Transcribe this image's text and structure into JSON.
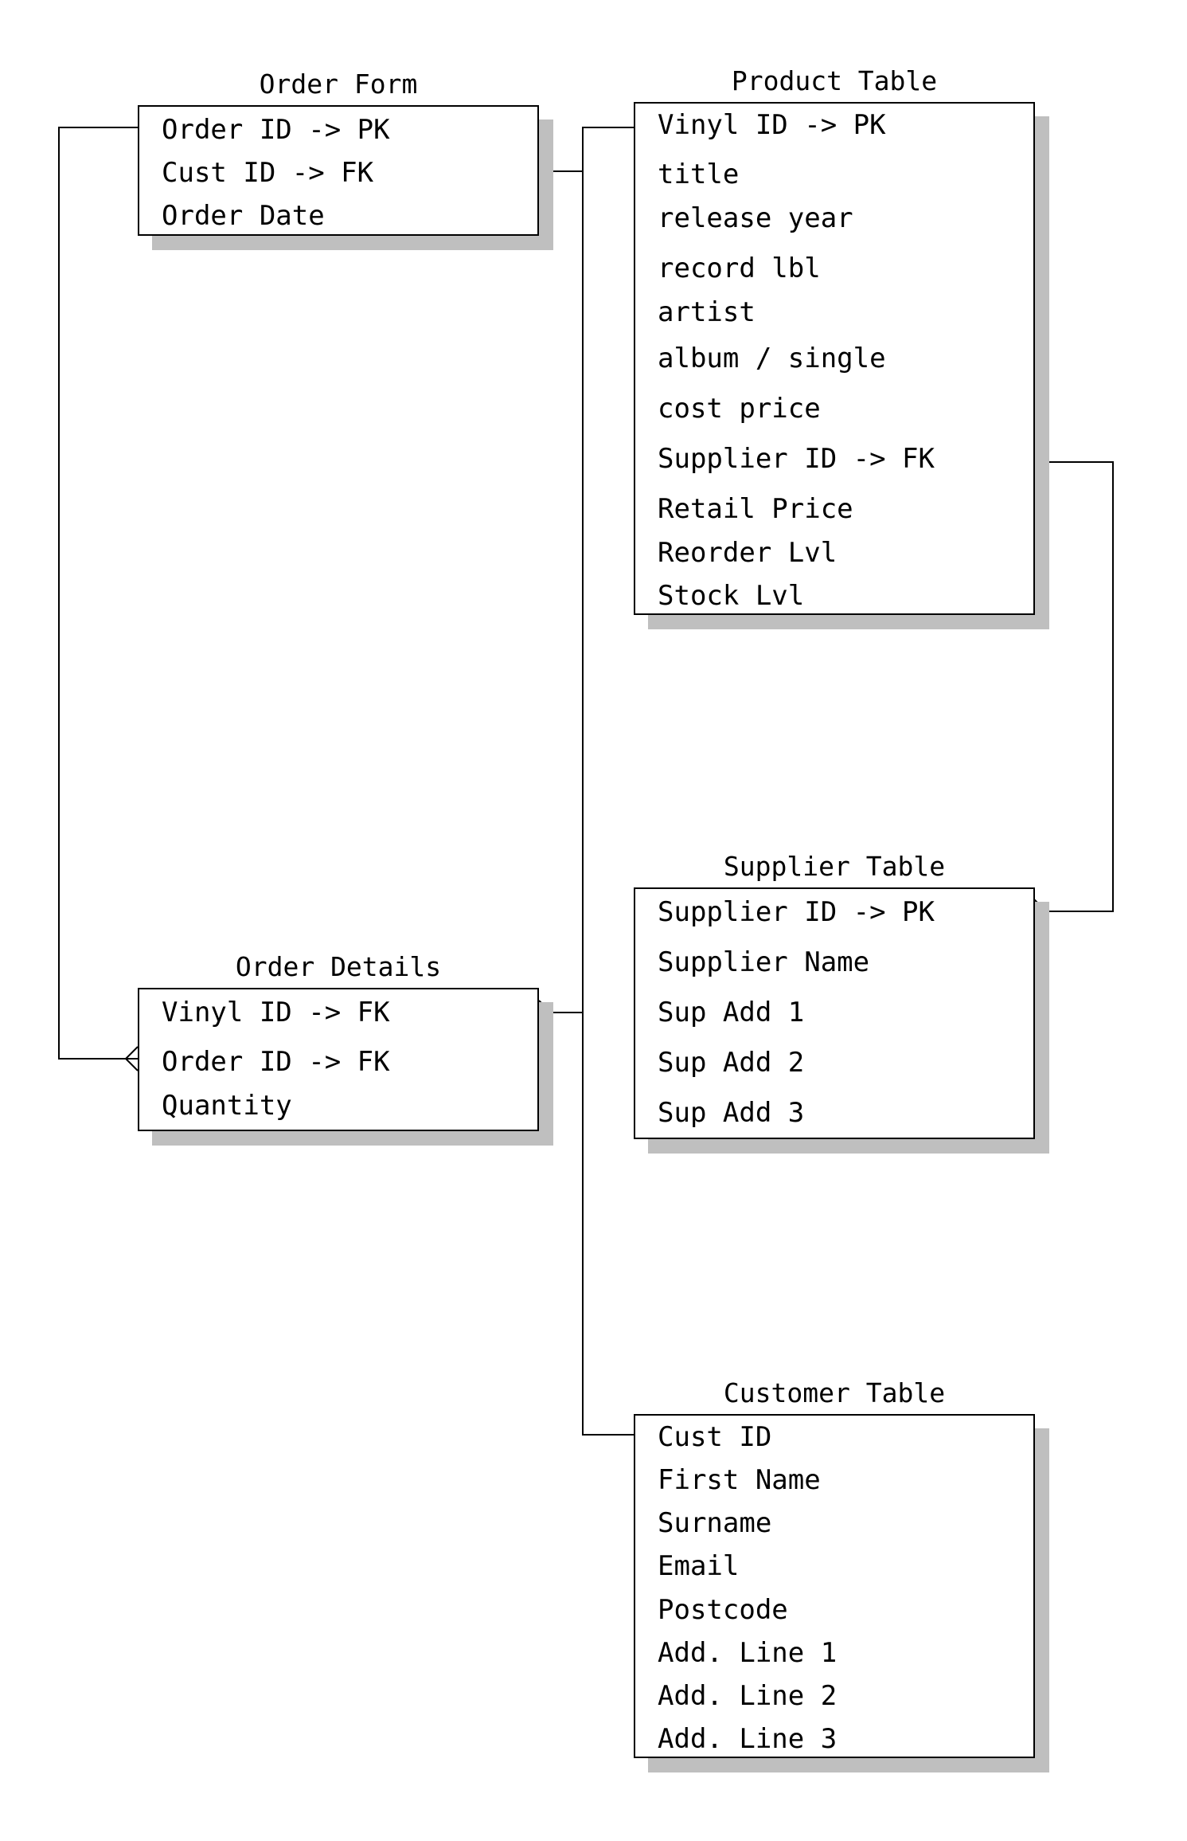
{
  "diagram": {
    "type": "entity-relationship",
    "entities": [
      {
        "id": "order-form",
        "title": "Order Form",
        "fields": [
          "Order ID -> PK",
          "Cust ID -> FK",
          "Order Date"
        ]
      },
      {
        "id": "product-table",
        "title": "Product Table",
        "fields": [
          "Vinyl ID -> PK",
          "title",
          "release year",
          "record lbl",
          "artist",
          "album / single",
          "cost price",
          "Supplier ID -> FK",
          "Retail Price",
          "Reorder Lvl",
          "Stock Lvl"
        ]
      },
      {
        "id": "supplier-table",
        "title": "Supplier Table",
        "fields": [
          "Supplier ID -> PK",
          "Supplier Name",
          "Sup Add 1",
          "Sup Add 2",
          "Sup Add 3"
        ]
      },
      {
        "id": "order-details",
        "title": "Order Details",
        "fields": [
          "Vinyl ID -> FK",
          "Order ID -> FK",
          "Quantity"
        ]
      },
      {
        "id": "customer-table",
        "title": "Customer Table",
        "fields": [
          "Cust ID",
          "First Name",
          "Surname",
          "Email",
          "Postcode",
          "Add. Line 1",
          "Add. Line 2",
          "Add. Line 3"
        ]
      }
    ],
    "relationships": [
      {
        "from": "order-form.Order ID -> PK",
        "to": "order-details.Order ID -> FK",
        "cardinality": "one-to-many"
      },
      {
        "from": "product-table.Vinyl ID -> PK",
        "to": "order-details.Vinyl ID -> FK",
        "cardinality": "one-to-many"
      },
      {
        "from": "customer-table.Cust ID",
        "to": "order-form.Cust ID -> FK",
        "cardinality": "one-to-many"
      },
      {
        "from": "product-table.Supplier ID -> FK",
        "to": "supplier-table.Supplier ID -> PK",
        "cardinality": "many-to-one"
      }
    ]
  }
}
